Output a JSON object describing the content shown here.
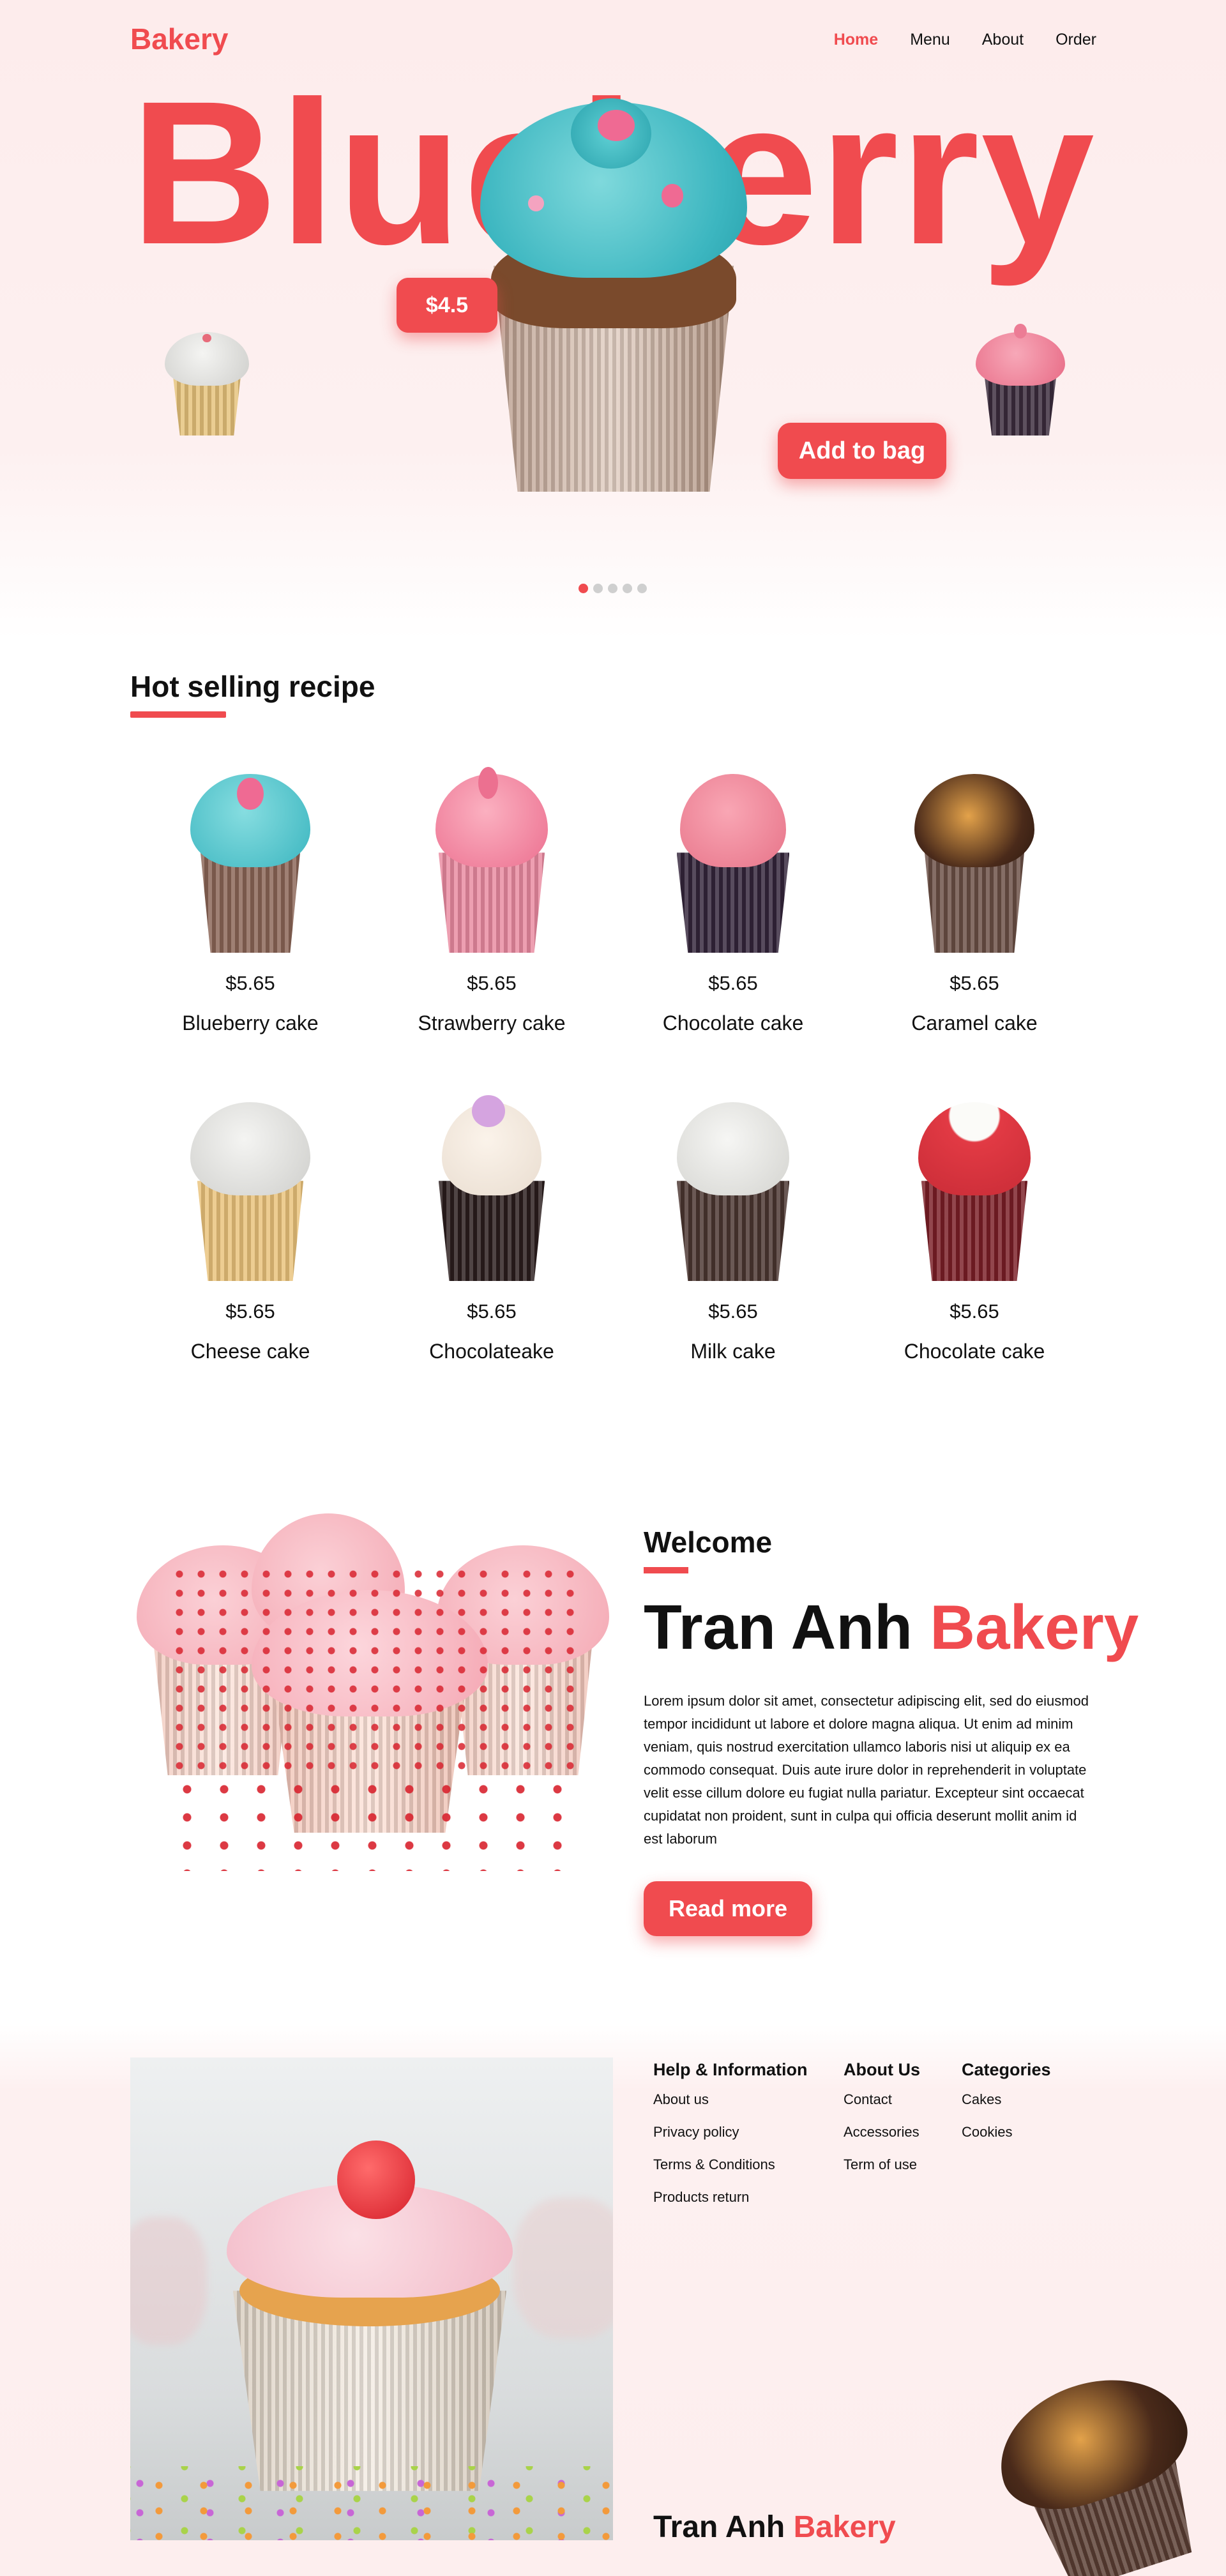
{
  "header": {
    "logo": "Bakery",
    "nav": [
      "Home",
      "Menu",
      "About",
      "Order"
    ],
    "active_nav": "Home"
  },
  "hero": {
    "title": "Blueberry",
    "price": "$4.5",
    "add_to_bag": "Add to bag",
    "slides_total": 5,
    "slide_active": 1
  },
  "hot_selling": {
    "title": "Hot selling recipe",
    "products": [
      {
        "price": "$5.65",
        "name": "Blueberry cake"
      },
      {
        "price": "$5.65",
        "name": "Strawberry cake"
      },
      {
        "price": "$5.65",
        "name": "Chocolate cake"
      },
      {
        "price": "$5.65",
        "name": "Caramel cake"
      },
      {
        "price": "$5.65",
        "name": "Cheese cake"
      },
      {
        "price": "$5.65",
        "name": "Chocolateake"
      },
      {
        "price": "$5.65",
        "name": "Milk cake"
      },
      {
        "price": "$5.65",
        "name": "Chocolate cake"
      }
    ]
  },
  "welcome": {
    "label": "Welcome",
    "brand_main": "Tran Anh",
    "brand_accent": "Bakery",
    "body": "Lorem ipsum dolor sit amet, consectetur adipiscing elit, sed do eiusmod tempor incididunt ut labore et dolore magna aliqua. Ut enim ad minim veniam, quis nostrud exercitation ullamco laboris nisi ut aliquip ex ea commodo consequat. Duis aute irure dolor in reprehenderit in voluptate velit esse cillum dolore eu fugiat nulla pariatur. Excepteur sint occaecat cupidatat non proident, sunt in culpa qui officia deserunt mollit anim id est laborum",
    "read_more": "Read more"
  },
  "footer": {
    "columns": [
      {
        "title": "Help & Information",
        "links": [
          "About us",
          "Privacy policy",
          "Terms & Conditions",
          "Products return"
        ]
      },
      {
        "title": "About Us",
        "links": [
          "Contact",
          "Accessories",
          "Term of use"
        ]
      },
      {
        "title": "Categories",
        "links": [
          "Cakes",
          "Cookies"
        ]
      }
    ],
    "brand_main": "Tran Anh",
    "brand_accent": "Bakery"
  },
  "colors": {
    "accent": "#f04b4f",
    "hero_bg": "#fdecec",
    "text": "#111111"
  }
}
